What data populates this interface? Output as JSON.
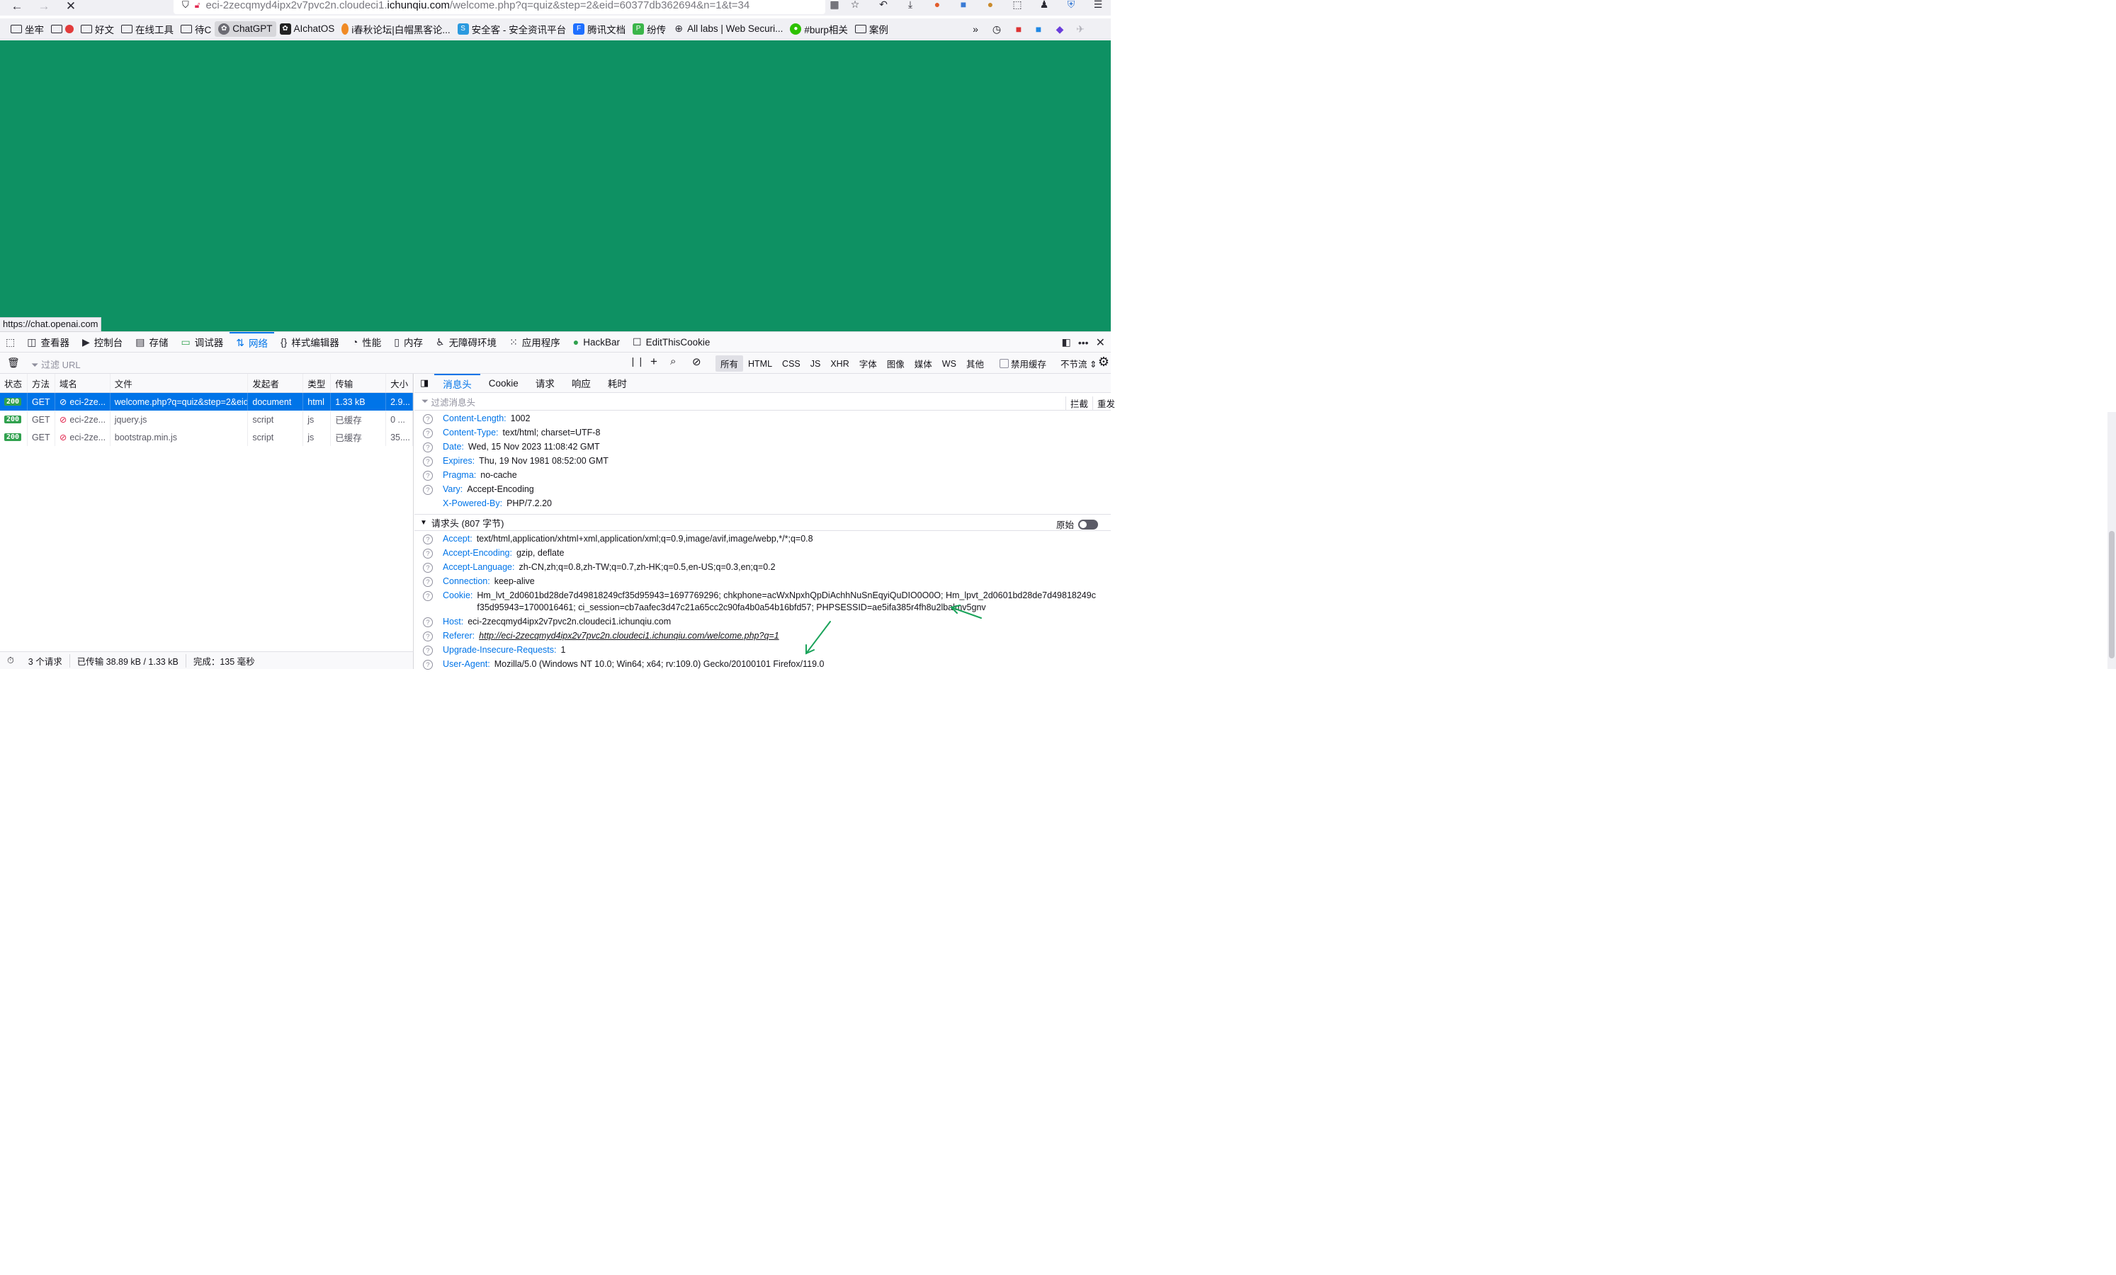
{
  "browser": {
    "url_prefix": "eci-2zecqmyd4ipx2v7pvc2n.cloudeci1.",
    "url_host": "ichunqiu.com",
    "url_suffix": "/welcome.php?q=quiz&step=2&eid=60377db362694&n=1&t=34"
  },
  "bookmarks": [
    {
      "label": "坐牢",
      "icon": "folder-icon"
    },
    {
      "label": "",
      "icon": "folder-icon"
    },
    {
      "label": "好文",
      "icon": "folder-icon"
    },
    {
      "label": "在线工具",
      "icon": "folder-icon"
    },
    {
      "label": "待C",
      "icon": "folder-icon"
    },
    {
      "label": "ChatGPT",
      "icon": "chatgpt-icon",
      "active": true
    },
    {
      "label": "AIchatOS",
      "icon": "aichatos-icon"
    },
    {
      "label": "i春秋论坛|白帽黑客论...",
      "icon": "ichunqiu-icon"
    },
    {
      "label": "安全客 - 安全资讯平台",
      "icon": "anquanke-icon"
    },
    {
      "label": "腾讯文档",
      "icon": "tencent-docs-icon"
    },
    {
      "label": "纷传",
      "icon": "fenchuan-icon"
    },
    {
      "label": "All labs | Web Securi...",
      "icon": "globe-icon"
    },
    {
      "label": "#burp相关",
      "icon": "wechat-icon"
    },
    {
      "label": "案例",
      "icon": "folder-icon"
    }
  ],
  "status_link": "https://chat.openai.com",
  "devtools": {
    "tabs": [
      {
        "label": "查看器",
        "icon": "inspector-icon"
      },
      {
        "label": "控制台",
        "icon": "console-icon"
      },
      {
        "label": "存储",
        "icon": "storage-icon"
      },
      {
        "label": "调试器",
        "icon": "debugger-icon"
      },
      {
        "label": "网络",
        "icon": "network-icon",
        "selected": true
      },
      {
        "label": "样式编辑器",
        "icon": "style-editor-icon"
      },
      {
        "label": "性能",
        "icon": "performance-icon"
      },
      {
        "label": "内存",
        "icon": "memory-icon"
      },
      {
        "label": "无障碍环境",
        "icon": "accessibility-icon"
      },
      {
        "label": "应用程序",
        "icon": "application-icon"
      },
      {
        "label": "HackBar",
        "icon": "hackbar-icon"
      },
      {
        "label": "EditThisCookie",
        "icon": "editthiscookie-icon"
      }
    ],
    "filter_url_placeholder": "过滤 URL",
    "type_filters": [
      "所有",
      "HTML",
      "CSS",
      "JS",
      "XHR",
      "字体",
      "图像",
      "媒体",
      "WS",
      "其他"
    ],
    "disable_cache": "禁用缓存",
    "throttle": "不节流 ⇕"
  },
  "request_list": {
    "columns": [
      "状态",
      "方法",
      "域名",
      "文件",
      "发起者",
      "类型",
      "传输",
      "大小"
    ],
    "rows": [
      {
        "status": "200",
        "method": "GET",
        "domain": "eci-2ze...",
        "file": "welcome.php?q=quiz&step=2&eid",
        "initiator": "document",
        "type": "html",
        "transfer": "1.33 kB",
        "size": "2.9...",
        "selected": true
      },
      {
        "status": "200",
        "method": "GET",
        "domain": "eci-2ze...",
        "file": "jquery.js",
        "initiator": "script",
        "type": "js",
        "transfer": "已缓存",
        "size": "0 ...",
        "selected": false
      },
      {
        "status": "200",
        "method": "GET",
        "domain": "eci-2ze...",
        "file": "bootstrap.min.js",
        "initiator": "script",
        "type": "js",
        "transfer": "已缓存",
        "size": "35....",
        "selected": false
      }
    ]
  },
  "details": {
    "tabs": [
      "消息头",
      "Cookie",
      "请求",
      "响应",
      "耗时"
    ],
    "filter_placeholder": "过滤消息头",
    "block_label": "拦截",
    "resend_label": "重发",
    "response_headers": [
      {
        "name": "Content-Length:",
        "value": "1002"
      },
      {
        "name": "Content-Type:",
        "value": "text/html; charset=UTF-8"
      },
      {
        "name": "Date:",
        "value": "Wed, 15 Nov 2023 11:08:42 GMT"
      },
      {
        "name": "Expires:",
        "value": "Thu, 19 Nov 1981 08:52:00 GMT"
      },
      {
        "name": "Pragma:",
        "value": "no-cache"
      },
      {
        "name": "Vary:",
        "value": "Accept-Encoding"
      },
      {
        "name": "X-Powered-By:",
        "value": "PHP/7.2.20"
      }
    ],
    "request_section_title": "请求头 (807 字节)",
    "raw_label": "原始",
    "request_headers": [
      {
        "name": "Accept:",
        "value": "text/html,application/xhtml+xml,application/xml;q=0.9,image/avif,image/webp,*/*;q=0.8"
      },
      {
        "name": "Accept-Encoding:",
        "value": "gzip, deflate"
      },
      {
        "name": "Accept-Language:",
        "value": "zh-CN,zh;q=0.8,zh-TW;q=0.7,zh-HK;q=0.5,en-US;q=0.3,en;q=0.2"
      },
      {
        "name": "Connection:",
        "value": "keep-alive"
      },
      {
        "name": "Cookie:",
        "value": "Hm_lvt_2d0601bd28de7d49818249cf35d95943=1697769296; chkphone=acWxNpxhQpDiAchhNuSnEqyiQuDIO0O0O; Hm_lpvt_2d0601bd28de7d49818249cf35d95943=1700016461; ci_session=cb7aafec3d47c21a65cc2c90fa4b0a54b16bfd57; PHPSESSID=ae5ifa385r4fh8u2lbalmv5gnv"
      },
      {
        "name": "Host:",
        "value": "eci-2zecqmyd4ipx2v7pvc2n.cloudeci1.ichunqiu.com"
      },
      {
        "name": "Referer:",
        "value": "http://eci-2zecqmyd4ipx2v7pvc2n.cloudeci1.ichunqiu.com/welcome.php?q=1",
        "link": true
      },
      {
        "name": "Upgrade-Insecure-Requests:",
        "value": "1"
      },
      {
        "name": "User-Agent:",
        "value": "Mozilla/5.0 (Windows NT 10.0; Win64; x64; rv:109.0) Gecko/20100101 Firefox/119.0"
      }
    ]
  },
  "statusbar": {
    "requests": "3 个请求",
    "transferred": "已传输 38.89 kB / 1.33 kB",
    "finished": "完成：135 毫秒"
  }
}
